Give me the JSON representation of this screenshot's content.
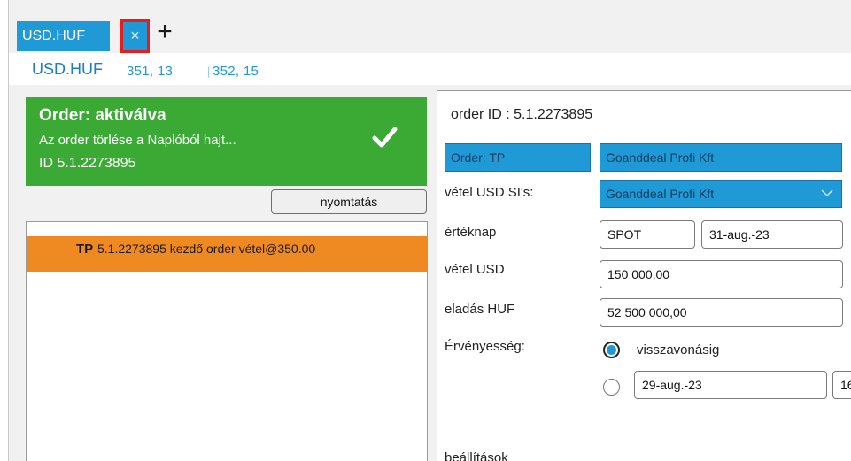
{
  "tab": {
    "label": "USD.HUF",
    "close_glyph": "×",
    "add_glyph": "+"
  },
  "header": {
    "pair": "USD.HUF",
    "rate_bid": "351, 13",
    "rate_sep": "|",
    "rate_ask": "352, 15"
  },
  "status": {
    "title": "Order: aktiválva",
    "message": "Az order törlése a Naplóból hajt...",
    "id_text": "ID 5.1.2273895",
    "icon": "checkmark-icon",
    "color": "#3aaa35"
  },
  "print_button": "nyomtatás",
  "orders": [
    {
      "tag": "TP",
      "text": "5.1.2273895 kezdő order vétel@350.00",
      "color": "#ee8a21"
    }
  ],
  "detail": {
    "order_id": "order ID : 5.1.2273895",
    "order_type": "Order: TP",
    "counterparty": "Goanddeal Profi Kft",
    "ssi_label": "vétel USD SI's:",
    "ssi_value": "Goanddeal Profi Kft",
    "value_date_label": "értéknap",
    "value_date_type": "SPOT",
    "value_date": "31-aug.-23",
    "buy_label": "vétel USD",
    "buy_amount": "150 000,00",
    "sell_label": "eladás HUF",
    "sell_amount": "52 500 000,00",
    "validity_label": "Érvényesség:",
    "validity_option1": "visszavonásig",
    "validity_date": "29-aug.-23",
    "validity_time": "16",
    "settings_label": "beállítások",
    "accent": "#1f9ad7"
  }
}
